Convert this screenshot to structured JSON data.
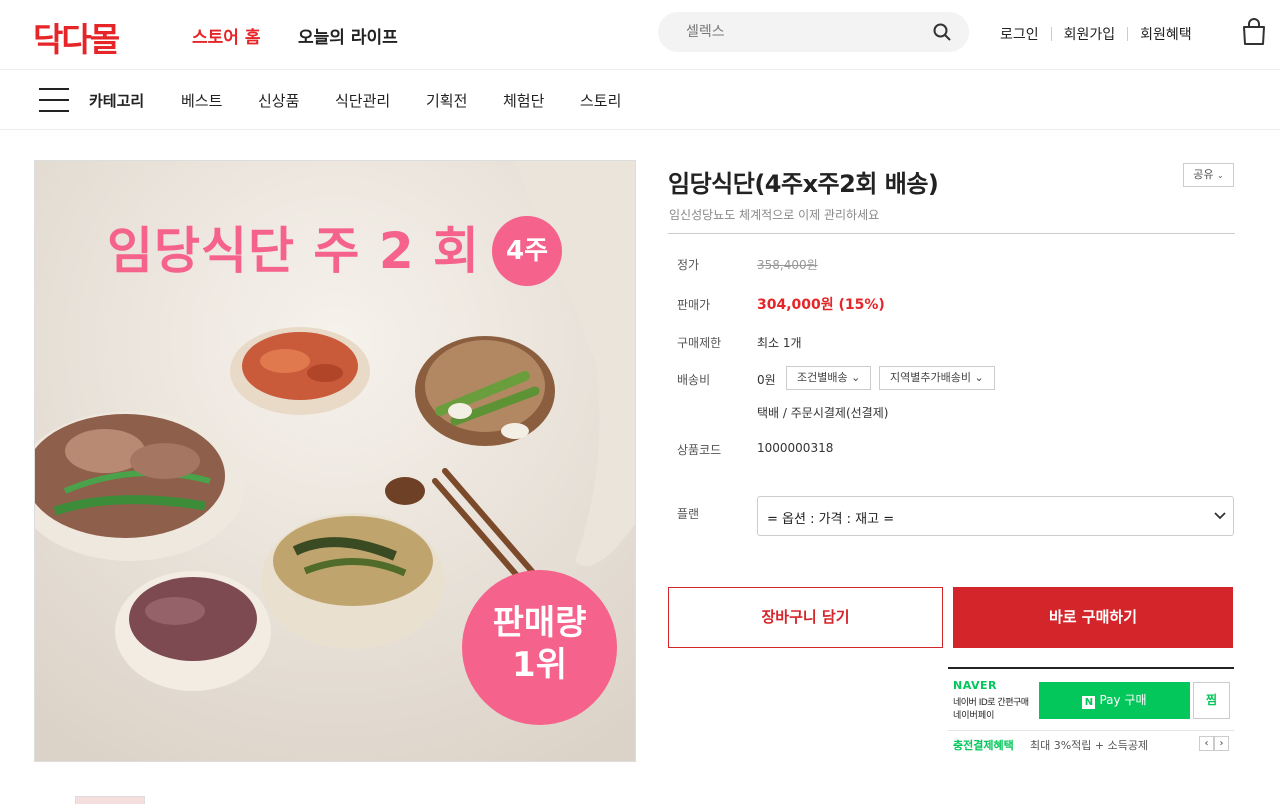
{
  "header": {
    "logo": "닥다몰",
    "store_home": "스토어 홈",
    "today_life": "오늘의 라이프",
    "search_placeholder": "셀렉스",
    "login": "로그인",
    "signup": "회원가입",
    "benefits": "회원혜택"
  },
  "nav": {
    "items": [
      "카테고리",
      "베스트",
      "신상품",
      "식단관리",
      "기획전",
      "체험단",
      "스토리"
    ]
  },
  "image": {
    "headline": "임당식단 주 2 회",
    "week_badge": "4주",
    "sales_badge_line1": "판매량",
    "sales_badge_line2": "1위"
  },
  "product": {
    "title": "임당식단(4주x주2회 배송)",
    "share": "공유",
    "subtitle": "임신성당뇨도 체계적으로 이제 관리하세요",
    "list_price_label": "정가",
    "list_price": "358,400원",
    "sale_price_label": "판매가",
    "sale_price": "304,000원 (15%)",
    "limit_label": "구매제한",
    "limit_value": "최소 1개",
    "shipping_label": "배송비",
    "shipping_value": "0원",
    "shipping_chip1": "조건별배송",
    "shipping_chip2": "지역별추가배송비",
    "shipping_method": "택배  /  주문시결제(선결제)",
    "code_label": "상품코드",
    "code_value": "1000000318",
    "plan_label": "플랜",
    "plan_selected": "= 옵션 : 가격 : 재고 =",
    "cart_button": "장바구니 담기",
    "buy_button": "바로 구매하기"
  },
  "npay": {
    "logo": "NAVER",
    "desc1": "네이버 ID로 간편구매",
    "desc2": "네이버페이",
    "button": "Pay 구매",
    "n_mark": "N",
    "wish": "찜",
    "benefit": "충전결제혜택",
    "benefit_desc": "최대 3%적립 + 소득공제",
    "prev": "‹",
    "next": "›"
  },
  "colors": {
    "brand_red": "#e52528",
    "button_red": "#d4252a",
    "naver_green": "#03c75a",
    "badge_pink": "#f5628b"
  }
}
